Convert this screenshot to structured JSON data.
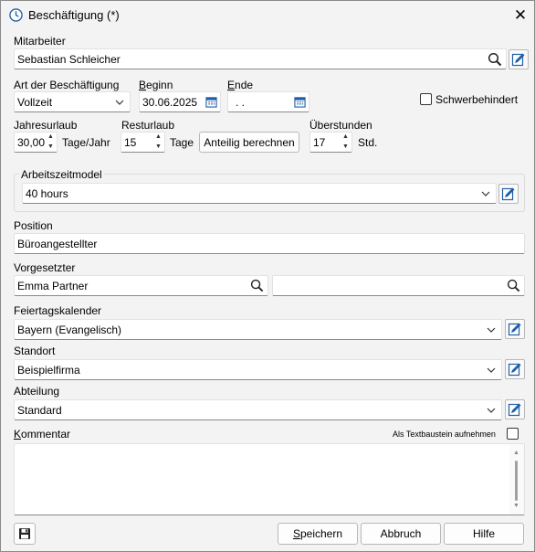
{
  "window": {
    "title": "Beschäftigung (*)",
    "close_glyph": "✕"
  },
  "mitarbeiter": {
    "label": "Mitarbeiter",
    "value": "Sebastian Schleicher"
  },
  "art": {
    "label": "Art der Beschäftigung",
    "value": "Vollzeit"
  },
  "beginn": {
    "label_ul": "B",
    "label_rest": "eginn",
    "value": "30.06.2025"
  },
  "ende": {
    "label_ul": "E",
    "label_rest": "nde",
    "value": ". ."
  },
  "schwerbehindert": {
    "label": "Schwerbehindert",
    "checked": false
  },
  "jahresurlaub": {
    "label": "Jahresurlaub",
    "value": "30,00",
    "unit": "Tage/Jahr"
  },
  "resturlaub": {
    "label": "Resturlaub",
    "value": "15",
    "unit": "Tage",
    "button": "Anteilig berechnen"
  },
  "ueberstunden": {
    "label": "Überstunden",
    "value": "17",
    "unit": "Std."
  },
  "arbeitszeitmodel": {
    "label": "Arbeitszeitmodel",
    "value": "40 hours"
  },
  "position": {
    "label": "Position",
    "value": "Büroangestellter"
  },
  "vorgesetzter": {
    "label": "Vorgesetzter",
    "value": "Emma Partner",
    "value2": ""
  },
  "feiertagskalender": {
    "label": "Feiertagskalender",
    "value": "Bayern (Evangelisch)"
  },
  "standort": {
    "label": "Standort",
    "value": "Beispielfirma"
  },
  "abteilung": {
    "label": "Abteilung",
    "value": "Standard"
  },
  "kommentar": {
    "label_ul": "K",
    "label_rest": "ommentar",
    "textbaustein_label": "Als Textbaustein aufnehmen",
    "textbaustein_checked": false,
    "value": ""
  },
  "footer": {
    "speichern_ul": "S",
    "speichern_rest": "peichern",
    "abbruch": "Abbruch",
    "hilfe": "Hilfe"
  },
  "icons": {
    "title": "clock-icon",
    "search": "search-icon",
    "edit": "edit-icon",
    "calendar": "calendar-icon",
    "chevron": "chevron-down-icon",
    "save": "floppy-disk-icon"
  },
  "colors": {
    "accent": "#1f5fa8",
    "window_bg": "#f3f3f3",
    "field_border": "#8a8a8a"
  }
}
